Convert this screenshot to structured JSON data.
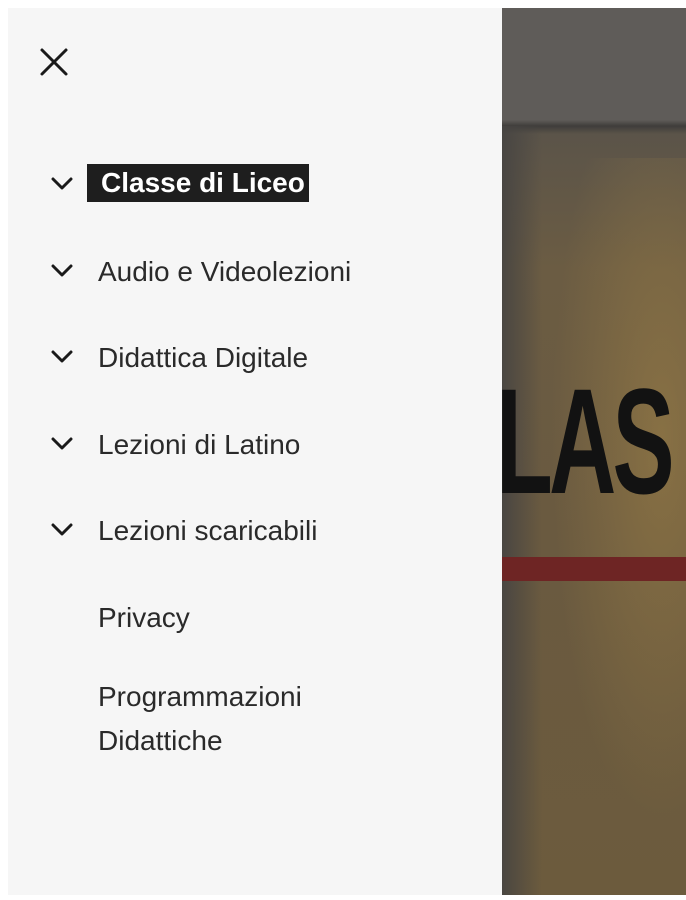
{
  "drawer": {
    "close_icon": "close-icon",
    "items": [
      {
        "label": "Classe di Liceo",
        "has_submenu": true,
        "active": true
      },
      {
        "label": "Audio e Videolezioni",
        "has_submenu": true,
        "active": false
      },
      {
        "label": "Didattica Digitale",
        "has_submenu": true,
        "active": false
      },
      {
        "label": "Lezioni di Latino",
        "has_submenu": true,
        "active": false
      },
      {
        "label": "Lezioni scaricabili",
        "has_submenu": true,
        "active": false
      },
      {
        "label": "Privacy",
        "has_submenu": false,
        "active": false
      },
      {
        "label": "Programmazioni Didattiche",
        "has_submenu": false,
        "active": false
      }
    ]
  },
  "background": {
    "hero_text": "LAS"
  },
  "colors": {
    "drawer_bg": "#f6f6f6",
    "active_bg": "#1e1e1e",
    "text": "#2a2a2a",
    "accent_bar": "#6e2524"
  }
}
